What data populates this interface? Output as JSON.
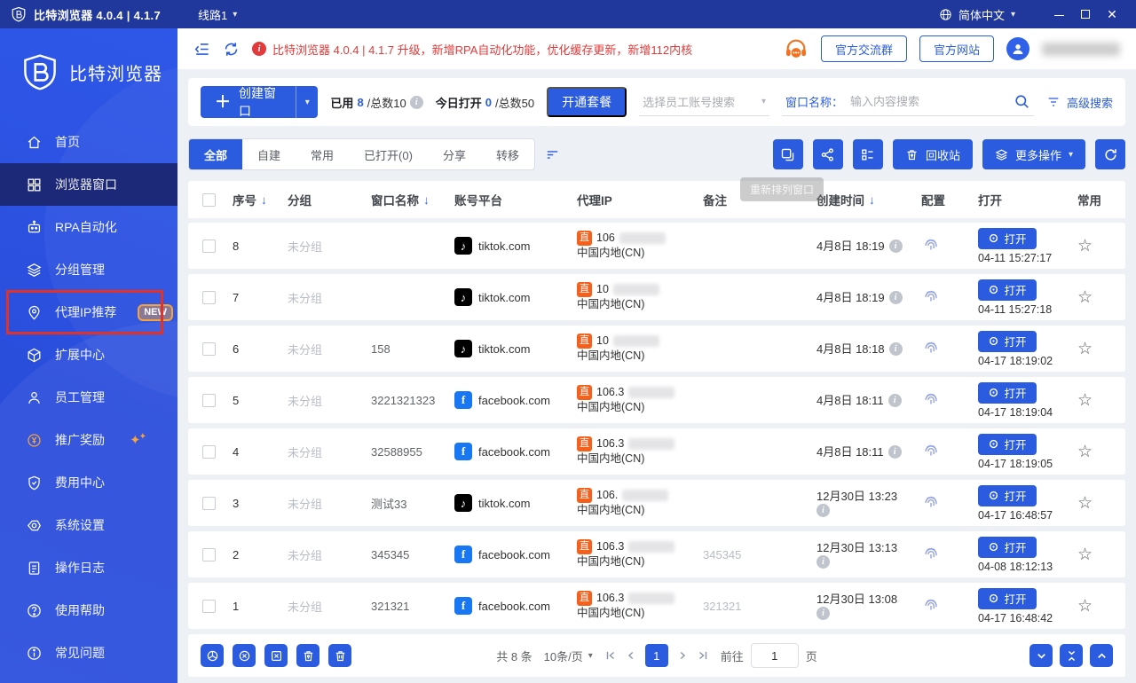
{
  "colors": {
    "accent": "#2b5ce0",
    "danger": "#e23a3a",
    "orange": "#f3701d",
    "badge_orange": "#f5a33c",
    "proxy_badge_bg": "#f4611c"
  },
  "titlebar": {
    "app_title": "比特浏览器 4.0.4 | 4.1.7",
    "line_selector": "线路1",
    "language": "简体中文"
  },
  "sidebar": {
    "logo_text": "比特浏览器",
    "items": [
      {
        "label": "首页",
        "icon": "home-icon"
      },
      {
        "label": "浏览器窗口",
        "icon": "windows-grid-icon",
        "active": true
      },
      {
        "label": "RPA自动化",
        "icon": "robot-icon"
      },
      {
        "label": "分组管理",
        "icon": "layers-icon"
      },
      {
        "label": "代理IP推荐",
        "icon": "location-pin-icon",
        "badge": "NEW",
        "framed": true
      },
      {
        "label": "扩展中心",
        "icon": "extension-box-icon"
      },
      {
        "label": "员工管理",
        "icon": "person-icon"
      },
      {
        "label": "推广奖励",
        "icon": "coin-icon",
        "tint": "#f5a33c",
        "sparkle": true
      },
      {
        "label": "费用中心",
        "icon": "shield-icon"
      },
      {
        "label": "系统设置",
        "icon": "gear-icon"
      },
      {
        "label": "操作日志",
        "icon": "log-icon"
      },
      {
        "label": "使用帮助",
        "icon": "question-icon"
      },
      {
        "label": "常见问题",
        "icon": "info-icon"
      }
    ]
  },
  "topbar": {
    "announcement": "比特浏览器 4.0.4 | 4.1.7 升级，新增RPA自动化功能，优化缓存更新，新增112内核",
    "group_button": "官方交流群",
    "site_button": "官方网站"
  },
  "toolbar": {
    "create_label": "创建窗口",
    "used_bold": "已用",
    "used_value": "8",
    "used_total": "/总数10",
    "today_bold": "今日打开",
    "today_value": "0",
    "today_total": "/总数50",
    "plan_button": "开通套餐",
    "employee_placeholder": "选择员工账号搜索",
    "window_label": "窗口名称：",
    "search_placeholder": "输入内容搜索",
    "advanced": "高级搜索"
  },
  "tabs": [
    {
      "label": "全部",
      "active": true
    },
    {
      "label": "自建"
    },
    {
      "label": "常用"
    },
    {
      "label": "已打开(0)"
    },
    {
      "label": "分享"
    },
    {
      "label": "转移"
    }
  ],
  "actions": {
    "recycle": "回收站",
    "more": "更多操作",
    "tooltip": "重新排列窗口"
  },
  "table": {
    "proxy_badge": "直",
    "open_label": "打开",
    "headers": {
      "seq": "序号",
      "group": "分组",
      "name": "窗口名称",
      "platform": "账号平台",
      "proxy": "代理IP",
      "remark": "备注",
      "created": "创建时间",
      "config": "配置",
      "open": "打开",
      "favorite": "常用"
    },
    "rows": [
      {
        "seq": "8",
        "group": "未分组",
        "name": "",
        "platform": "tiktok",
        "platform_label": "tiktok.com",
        "ip_prefix": "106",
        "location": "中国内地(CN)",
        "remark": "",
        "created": "4月8日 18:19",
        "info_below": false,
        "opened": "04-11 15:27:17"
      },
      {
        "seq": "7",
        "group": "未分组",
        "name": "",
        "platform": "tiktok",
        "platform_label": "tiktok.com",
        "ip_prefix": "10",
        "location": "中国内地(CN)",
        "remark": "",
        "created": "4月8日 18:19",
        "info_below": false,
        "opened": "04-11 15:27:18"
      },
      {
        "seq": "6",
        "group": "未分组",
        "name": "158",
        "platform": "tiktok",
        "platform_label": "tiktok.com",
        "ip_prefix": "10",
        "location": "中国内地(CN)",
        "remark": "",
        "created": "4月8日 18:18",
        "info_below": false,
        "opened": "04-17 18:19:02"
      },
      {
        "seq": "5",
        "group": "未分组",
        "name": "3221321323",
        "platform": "facebook",
        "platform_label": "facebook.com",
        "ip_prefix": "106.3",
        "location": "中国内地(CN)",
        "remark": "",
        "created": "4月8日 18:11",
        "info_below": false,
        "opened": "04-17 18:19:04"
      },
      {
        "seq": "4",
        "group": "未分组",
        "name": "32588955",
        "platform": "facebook",
        "platform_label": "facebook.com",
        "ip_prefix": "106.3",
        "location": "中国内地(CN)",
        "remark": "",
        "created": "4月8日 18:11",
        "info_below": false,
        "opened": "04-17 18:19:05"
      },
      {
        "seq": "3",
        "group": "未分组",
        "name": "测试33",
        "platform": "tiktok",
        "platform_label": "tiktok.com",
        "ip_prefix": "106.",
        "location": "中国内地(CN)",
        "remark": "",
        "created": "12月30日 13:23",
        "info_below": true,
        "opened": "04-17 16:48:57"
      },
      {
        "seq": "2",
        "group": "未分组",
        "name": "345345",
        "platform": "facebook",
        "platform_label": "facebook.com",
        "ip_prefix": "106.3",
        "location": "中国内地(CN)",
        "remark": "345345",
        "created": "12月30日 13:13",
        "info_below": true,
        "opened": "04-08 18:12:13"
      },
      {
        "seq": "1",
        "group": "未分组",
        "name": "321321",
        "platform": "facebook",
        "platform_label": "facebook.com",
        "ip_prefix": "106.3",
        "location": "中国内地(CN)",
        "remark": "321321",
        "created": "12月30日 13:08",
        "info_below": true,
        "opened": "04-17 16:48:42"
      }
    ]
  },
  "footer": {
    "total": "共 8 条",
    "page_size": "10条/页",
    "current_page": "1",
    "goto_label": "前往",
    "goto_value": "1",
    "page_unit": "页"
  }
}
